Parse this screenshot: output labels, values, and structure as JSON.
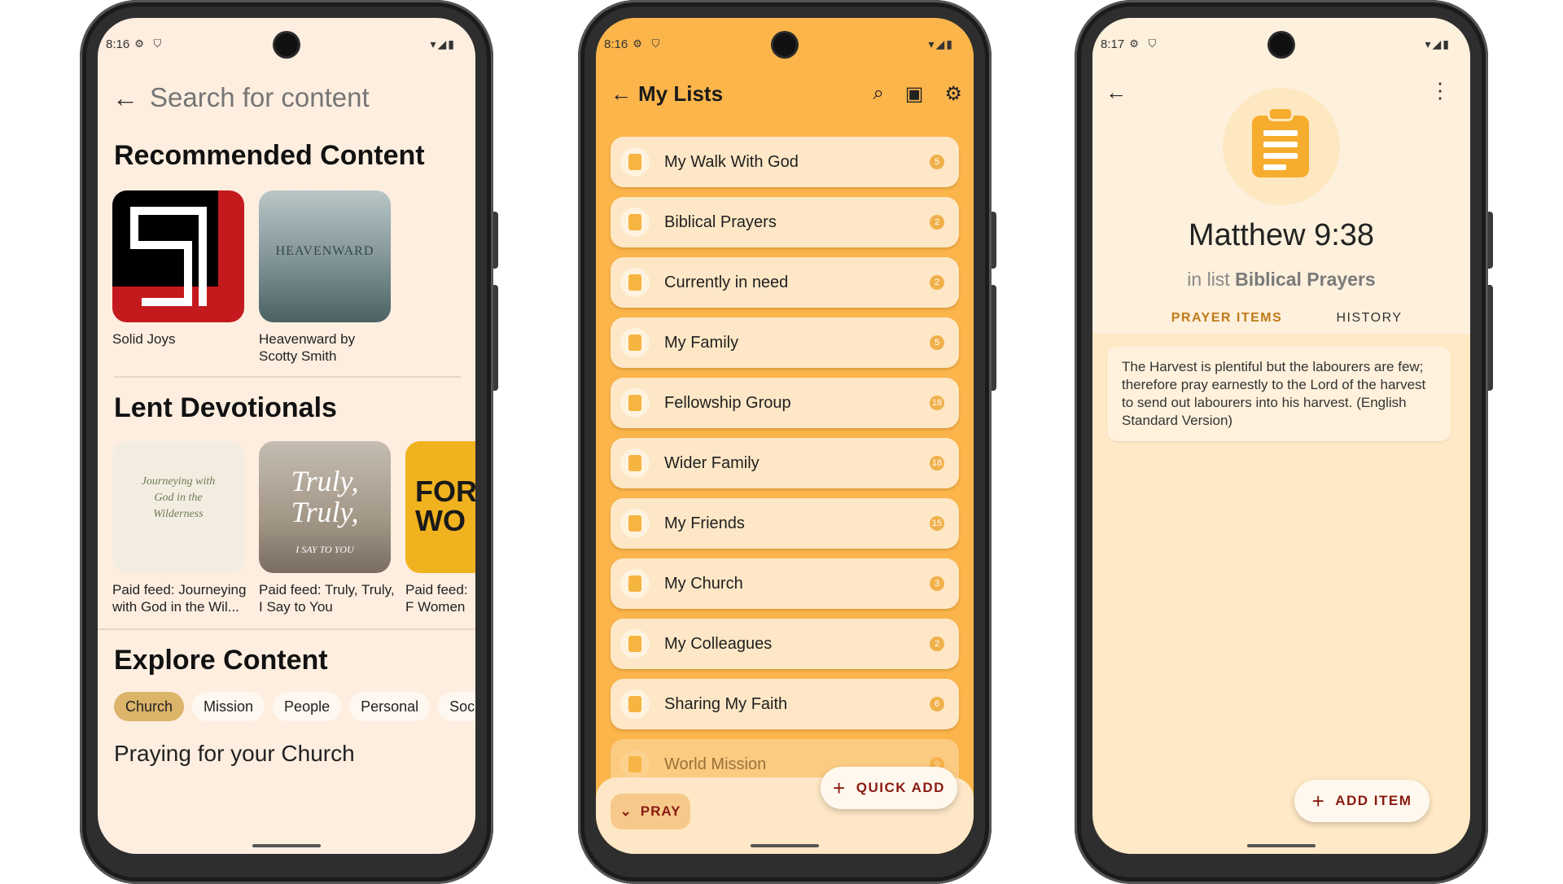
{
  "common": {
    "status_icons_left": "⚙ ⛉",
    "status_icons_right": "▾◢▮"
  },
  "screen1": {
    "time": "8:16",
    "search_placeholder": "Search for content",
    "recommended_title": "Recommended Content",
    "recommended": [
      {
        "caption": "Solid Joys",
        "art": "SJ"
      },
      {
        "caption": "Heavenward by Scotty Smith",
        "art": "HEAVENWARD"
      }
    ],
    "lent_title": "Lent Devotionals",
    "lent": [
      {
        "caption": "Paid feed: Journeying with God in the Wil...",
        "art": "Journeying with God in the Wilderness"
      },
      {
        "caption": "Paid feed: Truly, Truly, I Say to You",
        "art_big": "Truly, Truly,",
        "art_small": "I SAY TO YOU"
      },
      {
        "caption": "Paid feed: F Women",
        "art": "FOR WO"
      }
    ],
    "explore_title": "Explore Content",
    "chips": [
      "Church",
      "Mission",
      "People",
      "Personal",
      "Soc"
    ],
    "active_chip": "Church",
    "section_heading": "Praying for your Church"
  },
  "screen2": {
    "time": "8:16",
    "title": "My Lists",
    "icons": [
      "search-icon",
      "archive-icon",
      "gear-icon"
    ],
    "lists": [
      {
        "name": "My Walk With God",
        "count": "5"
      },
      {
        "name": "Biblical Prayers",
        "count": "2"
      },
      {
        "name": "Currently in need",
        "count": "2"
      },
      {
        "name": "My Family",
        "count": "5"
      },
      {
        "name": "Fellowship Group",
        "count": "18"
      },
      {
        "name": "Wider Family",
        "count": "18"
      },
      {
        "name": "My Friends",
        "count": "15"
      },
      {
        "name": "My Church",
        "count": "3"
      },
      {
        "name": "My Colleagues",
        "count": "2"
      },
      {
        "name": "Sharing My Faith",
        "count": "6"
      },
      {
        "name": "World Mission",
        "count": "9"
      }
    ],
    "quick_add": "QUICK ADD",
    "pray": "PRAY"
  },
  "screen3": {
    "time": "8:17",
    "verse_title": "Matthew 9:38",
    "in_list_prefix": "in list",
    "list_name": "Biblical Prayers",
    "tabs": [
      "PRAYER ITEMS",
      "HISTORY"
    ],
    "active_tab": "PRAYER ITEMS",
    "prayer_text": "The Harvest is plentiful but the labourers are few; therefore pray earnestly to the Lord of the harvest to send out labourers into his harvest. (English Standard Version)",
    "add_item": "ADD ITEM"
  },
  "colors": {
    "cream": "#fdeee0",
    "amber": "#fbb54b",
    "accent_red": "#8a1a12",
    "tab_gold": "#c07a17"
  }
}
